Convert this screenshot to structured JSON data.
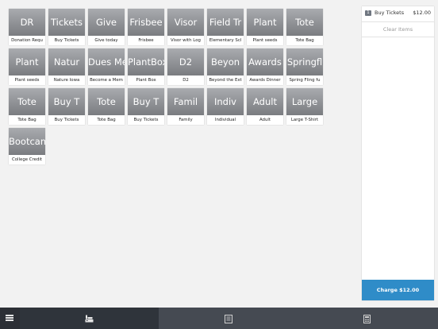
{
  "products": [
    {
      "label": "DR",
      "caption": "Donation Requ"
    },
    {
      "label": "Tickets",
      "caption": "Buy Tickets"
    },
    {
      "label": "Give",
      "caption": "Give today"
    },
    {
      "label": "Frisbee",
      "caption": "Frisbee"
    },
    {
      "label": "Visor",
      "caption": "Visor with Log"
    },
    {
      "label": "Field Tr",
      "caption": "Elementary Scl"
    },
    {
      "label": "Plant",
      "caption": "Plant seeds"
    },
    {
      "label": "Tote",
      "caption": "Tote Bag"
    },
    {
      "label": "Plant",
      "caption": "Plant seeds"
    },
    {
      "label": "Natur",
      "caption": "Nature Iowa"
    },
    {
      "label": "Dues Mem",
      "caption": "Become a Mem"
    },
    {
      "label": "PlantBox",
      "caption": "Plant Box"
    },
    {
      "label": "D2",
      "caption": "D2"
    },
    {
      "label": "Beyon",
      "caption": "Beyond the Ext"
    },
    {
      "label": "Awards",
      "caption": "Awards Dinner"
    },
    {
      "label": "Springfl",
      "caption": "Spring Fling fu"
    },
    {
      "label": "Tote",
      "caption": "Tote Bag"
    },
    {
      "label": "Buy T",
      "caption": "Buy Tickets"
    },
    {
      "label": "Tote",
      "caption": "Tote Bag"
    },
    {
      "label": "Buy T",
      "caption": "Buy Tickets"
    },
    {
      "label": "Famil",
      "caption": "Family"
    },
    {
      "label": "Indiv",
      "caption": "Individual"
    },
    {
      "label": "Adult",
      "caption": "Adult"
    },
    {
      "label": "Large",
      "caption": "Large T-Shirt"
    },
    {
      "label": "Bootcamp",
      "caption": "College Credit"
    }
  ],
  "cart": {
    "items": [
      {
        "qty": "1",
        "name": "Buy Tickets",
        "price": "$12.00"
      }
    ],
    "clear_label": "Clear Items",
    "charge_label": "Charge $12.00"
  },
  "nav": {
    "icons": {
      "menu": "hamburger-menu-icon",
      "register": "register-icon",
      "orders": "orders-icon",
      "calculator": "calculator-icon"
    },
    "active_tab": "register",
    "active_color": "#2f343b",
    "bar_color": "#454a52"
  },
  "colors": {
    "accent": "#2f8cc8",
    "tile_top": "#a9abaf",
    "tile_bottom": "#7a7c80"
  }
}
